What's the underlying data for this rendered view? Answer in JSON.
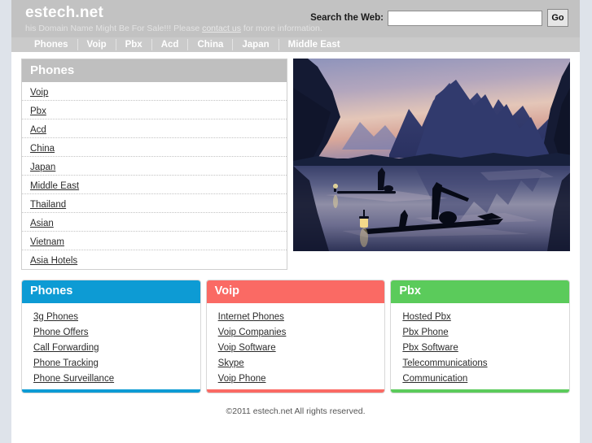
{
  "site": {
    "brand": "estech.net",
    "tagline_before": "his Domain Name Might Be For Sale!!! Please ",
    "tagline_link": "contact us",
    "tagline_after": " for more information."
  },
  "search": {
    "label": "Search the Web:",
    "value": "",
    "placeholder": "",
    "button": "Go"
  },
  "nav": {
    "items": [
      {
        "label": "Phones"
      },
      {
        "label": "Voip"
      },
      {
        "label": "Pbx"
      },
      {
        "label": "Acd"
      },
      {
        "label": "China"
      },
      {
        "label": "Japan"
      },
      {
        "label": "Middle East"
      }
    ]
  },
  "phones_panel": {
    "title": "Phones",
    "links": [
      {
        "label": "Voip"
      },
      {
        "label": "Pbx"
      },
      {
        "label": "Acd"
      },
      {
        "label": "China"
      },
      {
        "label": "Japan"
      },
      {
        "label": "Middle East"
      },
      {
        "label": "Thailand"
      },
      {
        "label": "Asian"
      },
      {
        "label": "Vietnam"
      },
      {
        "label": "Asia Hotels"
      }
    ]
  },
  "hero": {
    "alt": "Cormorant fishermen on the Li River at dusk with karst mountains"
  },
  "category_boxes": [
    {
      "title": "Phones",
      "color": "#0d9bd4",
      "links": [
        {
          "label": "3g Phones"
        },
        {
          "label": "Phone Offers"
        },
        {
          "label": "Call Forwarding"
        },
        {
          "label": "Phone Tracking"
        },
        {
          "label": "Phone Surveillance"
        }
      ]
    },
    {
      "title": "Voip",
      "color": "#fa6a64",
      "links": [
        {
          "label": "Internet Phones"
        },
        {
          "label": "Voip Companies"
        },
        {
          "label": "Voip Software"
        },
        {
          "label": "Skype"
        },
        {
          "label": "Voip Phone"
        }
      ]
    },
    {
      "title": "Pbx",
      "color": "#5bcb5b",
      "links": [
        {
          "label": "Hosted Pbx"
        },
        {
          "label": "Pbx Phone"
        },
        {
          "label": "Pbx Software"
        },
        {
          "label": "Telecommunications"
        },
        {
          "label": "Communication"
        }
      ]
    }
  ],
  "footer": {
    "copyright": "©2011 estech.net All rights reserved."
  }
}
